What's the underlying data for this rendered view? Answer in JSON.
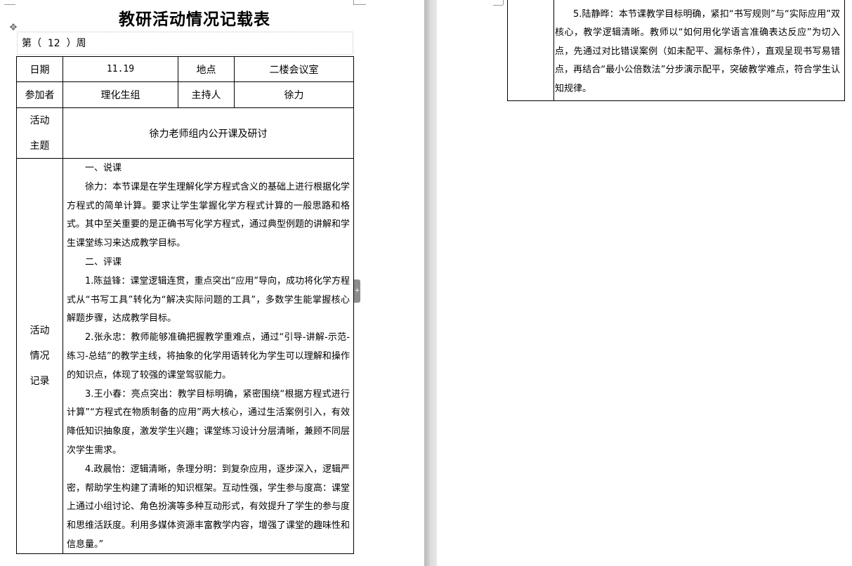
{
  "document": {
    "title": "教研活动情况记载表",
    "week_label": "第（  12  ）周"
  },
  "table": {
    "date_label": "日期",
    "date_value": "11.19",
    "location_label": "地点",
    "location_value": "二楼会议室",
    "participants_label": "参加者",
    "participants_value": "理化生组",
    "host_label": "主持人",
    "host_value": "徐力",
    "theme_label_lines": [
      "活动",
      "主题"
    ],
    "theme_value": "徐力老师组内公开课及研讨",
    "record_label_lines": [
      "活动",
      "情况",
      "记录"
    ]
  },
  "record": {
    "paragraphs": [
      "一、说课",
      "徐力：本节课是在学生理解化学方程式含义的基础上进行根据化学方程式的简单计算。要求让学生掌握化学方程式计算的一般思路和格式。其中至关重要的是正确书写化学方程式，通过典型例题的讲解和学生课堂练习来达成教学目标。",
      "二、评课",
      "1.陈益锋：课堂逻辑连贯，重点突出“应用”导向，成功将化学方程式从“书写工具”转化为“解决实际问题的工具”，多数学生能掌握核心解题步骤，达成教学目标。",
      "2.张永忠：教师能够准确把握教学重难点，通过“引导-讲解-示范-练习-总结”的教学主线，将抽象的化学用语转化为学生可以理解和操作的知识点，体现了较强的课堂驾驭能力。",
      "3.王小春：亮点突出：教学目标明确，紧密围绕“根据方程式进行计算”“方程式在物质制备的应用”两大核心，通过生活案例引入，有效降低知识抽象度，激发学生兴趣；课堂练习设计分层清晰，兼顾不同层次学生需求。",
      "4.政晨怡：逻辑清晰，条理分明：到复杂应用，逐步深入，逻辑严密，帮助学生构建了清晰的知识框架。互动性强，学生参与度高：课堂上通过小组讨论、角色扮演等多种互动形式，有效提升了学生的参与度和思维活跃度。利用多媒体资源丰富教学内容，增强了课堂的趣味性和信息量。”"
    ],
    "continued_paragraph": "5.陆静晔：本节课教学目标明确，紧扣“书写规则”与“实际应用”双核心，教学逻辑清晰。教师以“如何用化学语言准确表达反应”为切入点，先通过对比错误案例（如未配平、漏标条件），直观呈现书写易错点，再结合“最小公倍数法”分步演示配平，突破教学难点，符合学生认知规律。"
  },
  "icons": {
    "move_handle": "four-arrows-move-icon",
    "side_tab": "plus-icon"
  }
}
